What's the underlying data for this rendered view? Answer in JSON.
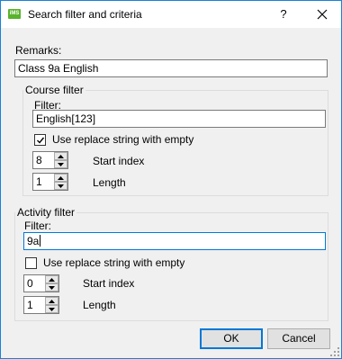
{
  "window": {
    "title": "Search filter and criteria",
    "icon": "app-icon",
    "help_label": "?",
    "accent_color": "#0078d7"
  },
  "remarks": {
    "label": "Remarks:",
    "value": "Class 9a English"
  },
  "course_filter": {
    "legend": "Course filter",
    "filter_label": "Filter:",
    "filter_value": "English[123]",
    "use_replace_label": "Use replace string with empty",
    "use_replace_checked": true,
    "start_index_label": "Start index",
    "start_index_value": "8",
    "length_label": "Length",
    "length_value": "1"
  },
  "activity_filter": {
    "legend": "Activity filter",
    "filter_label": "Filter:",
    "filter_value": "9a",
    "use_replace_label": "Use replace string with empty",
    "use_replace_checked": false,
    "start_index_label": "Start index",
    "start_index_value": "0",
    "length_label": "Length",
    "length_value": "1"
  },
  "buttons": {
    "ok": "OK",
    "cancel": "Cancel"
  }
}
